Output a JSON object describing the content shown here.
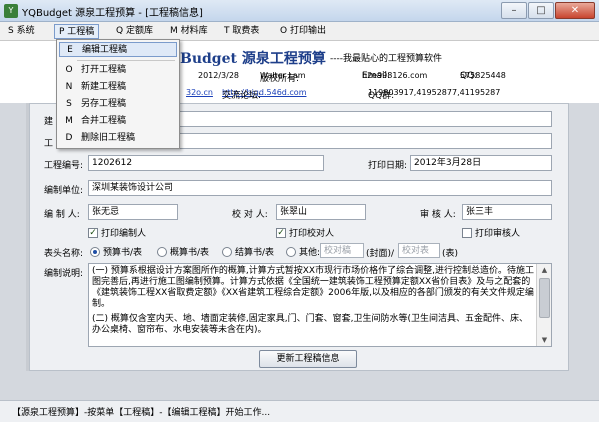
{
  "window": {
    "title": "YQBudget 源泉工程预算 - [工程稿信息]",
    "app_icon": "app-icon"
  },
  "menubar": {
    "items": [
      {
        "label": "S 系统"
      },
      {
        "label": "P 工程稿"
      },
      {
        "label": "Q 定额库"
      },
      {
        "label": "M 材料库"
      },
      {
        "label": "T 取费表"
      },
      {
        "label": "O 打印输出"
      }
    ]
  },
  "dropdown": {
    "items": [
      {
        "key": "E",
        "label": "编辑工程稿"
      },
      {
        "key": "O",
        "label": "打开工程稿"
      },
      {
        "key": "N",
        "label": "新建工程稿"
      },
      {
        "key": "S",
        "label": "另存工程稿"
      },
      {
        "key": "M",
        "label": "合并工程稿"
      },
      {
        "key": "D",
        "label": "删除旧工程稿"
      }
    ]
  },
  "header": {
    "brand": "Budget 源泉工程预算",
    "slogan": "----我最贴心的工程预算软件",
    "date": "2012/3/28",
    "copyright_label": "版权所有:",
    "copyright_value": "Walter Lam",
    "email_label": "Email:",
    "email_value": "h2e998126.com",
    "qq_label": "QQ:",
    "qq_value": "575825448",
    "site_link": "32o.cn",
    "forum_label": "交流论坛:",
    "forum_link": "http://bigd.546d.com",
    "qqgroup_label": "QQ群:",
    "qqgroup_value": "119803917,41952877,41195287"
  },
  "form": {
    "project_no_label": "工程编号:",
    "project_no": "1202612",
    "print_date_label": "打印日期:",
    "print_date": "2012年3月28日",
    "unit_label": "编制单位:",
    "unit": "深圳某装饰设计公司",
    "compiler_label": "编 制 人:",
    "compiler": "张无忌",
    "checker_label": "校 对 人:",
    "checker": "张翠山",
    "reviewer_label": "审 核 人:",
    "reviewer": "张三丰",
    "print_compiler": "打印编制人",
    "print_checker": "打印校对人",
    "print_reviewer": "打印审核人",
    "header_name_label": "表头名称:",
    "radio_options": [
      "预算书/表",
      "概算书/表",
      "结算书/表",
      "其他:"
    ],
    "selected_radio": 0,
    "other_placeholder_1": "校对稿",
    "cover_suffix": "(封面)/",
    "other_placeholder_2": "校对表",
    "table_suffix": "(表)",
    "notes_label": "编制说明:",
    "notes_p1": "(一) 预算系根据设计方案图所作的概算,计算方式暂按XX市现行市场价格作了综合调整,进行控制总造价。待施工图完善后,再进行施工图编制预算。计算方式依据《全国统一建筑装饰工程预算定额XX省价目表》及与之配套的《建筑装饰工程XX省取费定额》《XX省建筑工程综合定额》2006年版,以及相应的各部门颁发的有关文件规定编制。",
    "notes_p2": "(二) 概算仅含室内天、地、墙面定装修,固定家具,门、门套、窗套,卫生间防水等(卫生间洁具、五金配件、床、办公桌椅、窗帘布、水电安装等未含在内)。",
    "update_button": "更新工程稿信息"
  },
  "status": {
    "text": "【源泉工程预算】-按菜单【工程稿】-【编辑工程稿】开始工作..."
  }
}
